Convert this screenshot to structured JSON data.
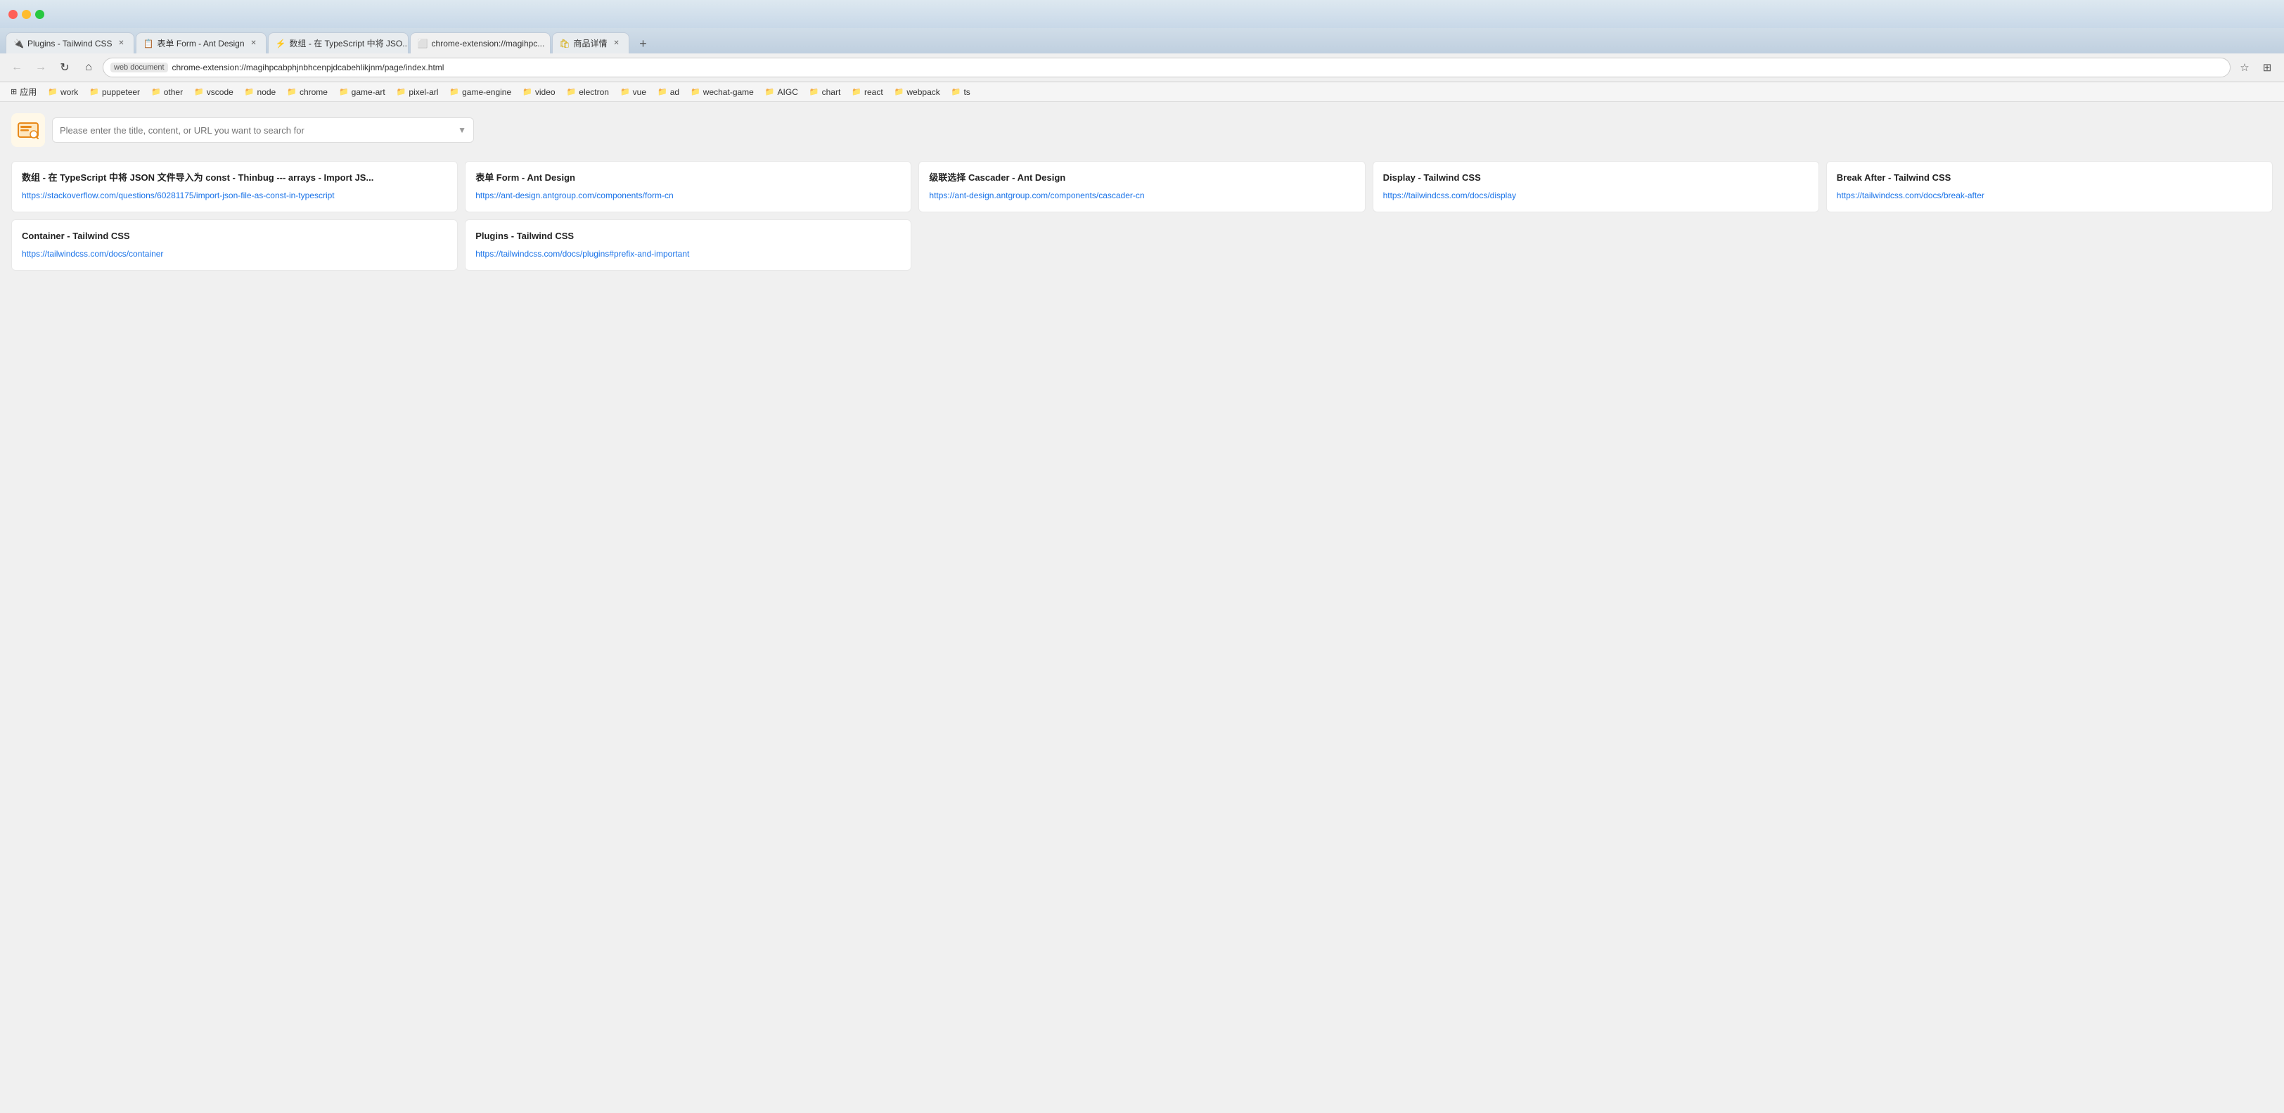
{
  "titlebar": {
    "traffic_lights": [
      "red",
      "yellow",
      "green"
    ]
  },
  "tabs": [
    {
      "id": "tab1",
      "favicon": "🔌",
      "favicon_color": "fav-orange",
      "label": "Plugins - Tailwind CSS",
      "active": false,
      "closable": true
    },
    {
      "id": "tab2",
      "favicon": "📋",
      "favicon_color": "fav-red",
      "label": "表单 Form - Ant Design",
      "active": false,
      "closable": true
    },
    {
      "id": "tab3",
      "favicon": "⚡",
      "favicon_color": "fav-orange",
      "label": "数组 - 在 TypeScript 中将 JSO...",
      "active": false,
      "closable": true
    },
    {
      "id": "tab4",
      "favicon": "🔲",
      "favicon_color": "fav-active",
      "label": "chrome-extension://magihpc...",
      "active": true,
      "closable": true
    },
    {
      "id": "tab5",
      "favicon": "🛍",
      "favicon_color": "fav-gold",
      "label": "商品详情",
      "active": false,
      "closable": true
    }
  ],
  "toolbar": {
    "back_disabled": true,
    "forward_disabled": true,
    "url_badge": "web document",
    "url": "chrome-extension://magihpcabphjnbhcenpjdcabehlikjnm/page/index.html"
  },
  "bookmarks": [
    {
      "icon": "⊞",
      "label": "应用"
    },
    {
      "icon": "📁",
      "label": "work"
    },
    {
      "icon": "📁",
      "label": "puppeteer"
    },
    {
      "icon": "📁",
      "label": "other"
    },
    {
      "icon": "📁",
      "label": "vscode"
    },
    {
      "icon": "📁",
      "label": "node"
    },
    {
      "icon": "📁",
      "label": "chrome"
    },
    {
      "icon": "📁",
      "label": "game-art"
    },
    {
      "icon": "📁",
      "label": "pixel-arl"
    },
    {
      "icon": "📁",
      "label": "game-engine"
    },
    {
      "icon": "📁",
      "label": "video"
    },
    {
      "icon": "📁",
      "label": "electron"
    },
    {
      "icon": "📁",
      "label": "vue"
    },
    {
      "icon": "📁",
      "label": "ad"
    },
    {
      "icon": "📁",
      "label": "wechat-game"
    },
    {
      "icon": "📁",
      "label": "AIGC"
    },
    {
      "icon": "📁",
      "label": "chart"
    },
    {
      "icon": "📁",
      "label": "react"
    },
    {
      "icon": "📁",
      "label": "webpack"
    },
    {
      "icon": "📁",
      "label": "ts"
    }
  ],
  "search": {
    "placeholder": "Please enter the title, content, or URL you want to search for"
  },
  "cards": [
    {
      "title": "数组 - 在 TypeScript 中将 JSON 文件导入为 const - Thinbug --- arrays - Import JS...",
      "url": "https://stackoverflow.com/questions/60281175/import-json-file-as-const-in-typescript",
      "url_highlighted": false
    },
    {
      "title": "表单 Form - Ant Design",
      "url": "https://ant-design.antgroup.com/components/form-cn",
      "url_highlighted": false
    },
    {
      "title": "级联选择 Cascader - Ant Design",
      "url": "https://ant-design.antgroup.com/components/cascader-cn",
      "url_highlighted": false
    },
    {
      "title": "Display - Tailwind CSS",
      "url": "https://tailwindcss.com/docs/display",
      "url_highlighted": true
    },
    {
      "title": "Break After - Tailwind CSS",
      "url": "https://tailwindcss.com/docs/break-after",
      "url_highlighted": false
    },
    {
      "title": "Container - Tailwind CSS",
      "url": "https://tailwindcss.com/docs/container",
      "url_highlighted": false
    },
    {
      "title": "Plugins - Tailwind CSS",
      "url": "https://tailwindcss.com/docs/plugins#prefix-and-important",
      "url_highlighted": false
    }
  ]
}
